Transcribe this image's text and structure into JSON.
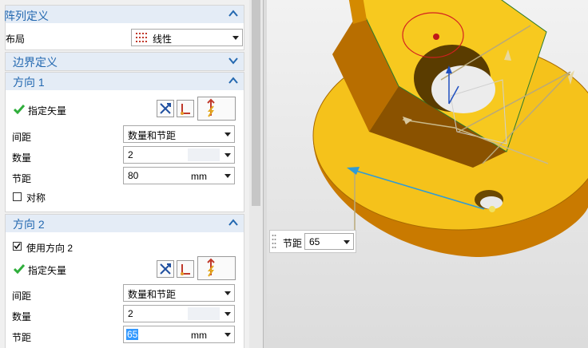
{
  "pattern_def": {
    "title": "阵列定义",
    "layout_label": "布局",
    "layout_value": "线性"
  },
  "boundary": {
    "title": "边界定义"
  },
  "dir1": {
    "title": "方向 1",
    "vector_label": "指定矢量",
    "spacing_label": "间距",
    "spacing_value": "数量和节距",
    "count_label": "数量",
    "count_value": "2",
    "pitch_label": "节距",
    "pitch_value": "80",
    "pitch_unit": "mm",
    "symmetric_label": "对称"
  },
  "dir2": {
    "title": "方向 2",
    "use_label": "使用方向 2",
    "use_checked": true,
    "vector_label": "指定矢量",
    "spacing_label": "间距",
    "spacing_value": "数量和节距",
    "count_label": "数量",
    "count_value": "2",
    "pitch_label": "节距",
    "pitch_value": "65",
    "pitch_unit": "mm"
  },
  "viewport_input": {
    "label": "节距",
    "value": "65"
  },
  "colors": {
    "accent": "#2368b0",
    "header_bg": "#e4ecf6",
    "part": "#f5c21b",
    "check": "#2fae3b",
    "arrow": "#2f9bd6"
  },
  "icons": [
    "chevron-up-icon",
    "chevron-down-icon",
    "checkmark-icon",
    "swap-direction-icon",
    "vector-icon",
    "inferred-vector-icon",
    "grip-icon"
  ]
}
